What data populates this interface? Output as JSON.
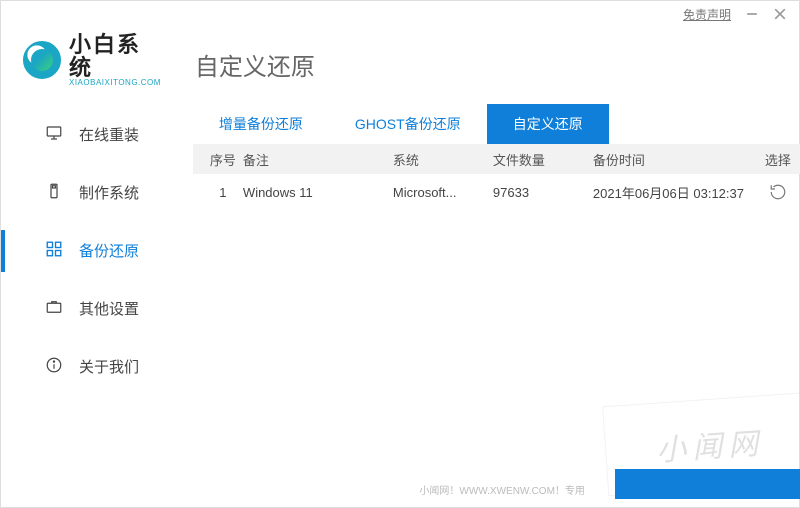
{
  "window": {
    "disclaimer": "免责声明"
  },
  "brand": {
    "title": "小白系统",
    "sub": "XIAOBAIXITONG.COM"
  },
  "nav": {
    "items": [
      {
        "label": "在线重装"
      },
      {
        "label": "制作系统"
      },
      {
        "label": "备份还原"
      },
      {
        "label": "其他设置"
      },
      {
        "label": "关于我们"
      }
    ]
  },
  "page": {
    "title": "自定义还原"
  },
  "tabs": {
    "items": [
      {
        "label": "增量备份还原"
      },
      {
        "label": "GHOST备份还原"
      },
      {
        "label": "自定义还原"
      }
    ]
  },
  "table": {
    "headers": {
      "seq": "序号",
      "remark": "备注",
      "system": "系统",
      "count": "文件数量",
      "time": "备份时间",
      "select": "选择"
    },
    "rows": [
      {
        "seq": "1",
        "remark": "Windows 11",
        "system": "Microsoft...",
        "count": "97633",
        "time": "2021年06月06日 03:12:37"
      }
    ]
  },
  "watermark": "小闻网",
  "footer": "小闻网！WWW.XWENW.COM！专用"
}
